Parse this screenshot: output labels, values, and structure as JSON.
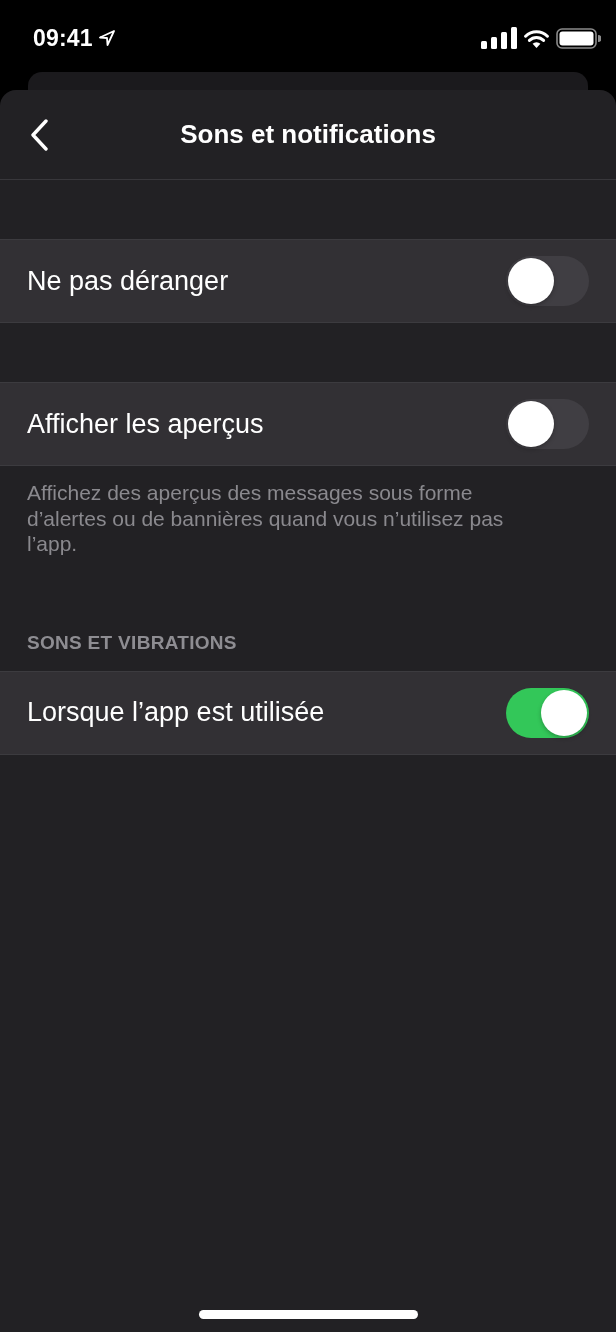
{
  "status_bar": {
    "time": "09:41"
  },
  "nav_bar": {
    "title": "Sons et notifications"
  },
  "sections": [
    {
      "rows": [
        {
          "label": "Ne pas déranger",
          "on": false
        }
      ]
    },
    {
      "rows": [
        {
          "label": "Afficher les aperçus",
          "on": false
        }
      ],
      "footer": "Affichez des aperçus des messages sous forme d’alertes ou de bannières quand vous n’utilisez pas l’app."
    },
    {
      "header": "SONS ET VIBRATIONS",
      "rows": [
        {
          "label": "Lorsque l’app est utilisée",
          "on": true
        }
      ]
    }
  ]
}
